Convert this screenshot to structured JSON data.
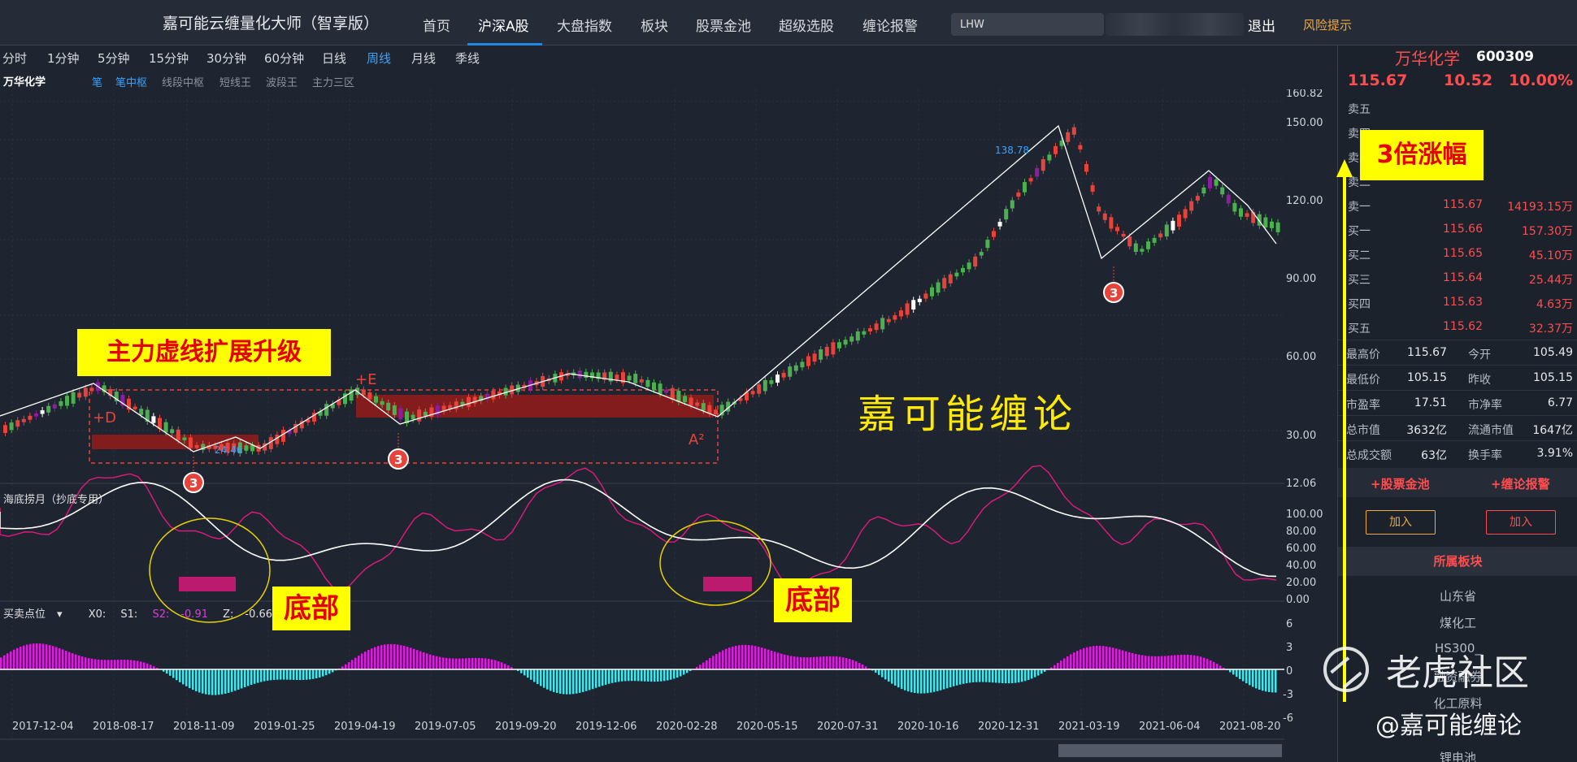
{
  "app": {
    "title": "嘉可能云缠量化大师（智享版）",
    "nav": [
      "首页",
      "沪深A股",
      "大盘指数",
      "板块",
      "股票金池",
      "超级选股",
      "缠论报警"
    ],
    "search_value": "LHW",
    "logout": "退出",
    "risk": "风险提示"
  },
  "periods": [
    "分时",
    "1分钟",
    "5分钟",
    "15分钟",
    "30分钟",
    "60分钟",
    "日线",
    "周线",
    "月线",
    "季线"
  ],
  "active_period": "周线",
  "indicator_bar": {
    "stock": "万华化学",
    "items": [
      "笔",
      "笔中枢",
      "线段中枢",
      "短线王",
      "波段王",
      "主力三区"
    ]
  },
  "main_chart": {
    "y_ticks": [
      "160.82",
      "150.00",
      "120.00",
      "90.00",
      "60.00",
      "30.00",
      "12.06"
    ],
    "price_marks": [
      "138.78",
      "24.46"
    ],
    "labels": [
      "+D",
      "+E",
      "A²"
    ],
    "badge": "3"
  },
  "oscillator": {
    "title": "海底捞月（抄底专用）",
    "y_ticks": [
      "100.00",
      "80.00",
      "60.00",
      "40.00",
      "20.00",
      "0.00"
    ]
  },
  "buy_sell": {
    "title": "买卖点位",
    "x0_label": "X0:",
    "s1_label": "S1:",
    "s2_label": "S2:",
    "s2_value": "-0.91",
    "z_label": "Z:",
    "z_value": "-0.66",
    "y_ticks": [
      "6",
      "3",
      "0",
      "-3",
      "-6"
    ]
  },
  "x_dates": [
    "2017-12-04",
    "2018-08-17",
    "2018-11-09",
    "2019-01-25",
    "2019-04-19",
    "2019-07-05",
    "2019-09-20",
    "2019-12-06",
    "2020-02-28",
    "2020-05-15",
    "2020-07-31",
    "2020-10-16",
    "2020-12-31",
    "2021-03-19",
    "2021-06-04",
    "2021-08-20"
  ],
  "quote": {
    "name": "万华化学",
    "code": "600309",
    "price": "115.67",
    "change": "10.52",
    "pct": "10.00%",
    "sells_empty": [
      "卖五",
      "卖四",
      "卖三",
      "卖二"
    ],
    "sell1": {
      "label": "卖一",
      "price": "115.67",
      "vol": "14193.15万"
    },
    "buy1": {
      "label": "买一",
      "price": "115.66",
      "vol": "157.30万"
    },
    "buy2": {
      "label": "买二",
      "price": "115.65",
      "vol": "45.10万"
    },
    "buy3": {
      "label": "买三",
      "price": "115.64",
      "vol": "25.44万"
    },
    "buy4": {
      "label": "买四",
      "price": "115.63",
      "vol": "4.63万"
    },
    "buy5": {
      "label": "买五",
      "price": "115.62",
      "vol": "32.37万"
    }
  },
  "stats": [
    [
      "最高价",
      "115.67",
      "今开",
      "105.49"
    ],
    [
      "最低价",
      "105.15",
      "昨收",
      "105.15"
    ],
    [
      "市盈率",
      "17.51",
      "市净率",
      "6.77"
    ],
    [
      "总市值",
      "3632亿",
      "流通市值",
      "1647亿"
    ],
    [
      "总成交额",
      "63亿",
      "换手率",
      "3.91%"
    ]
  ],
  "panel_tabs": [
    "+股票金池",
    "+缠论报警"
  ],
  "add_label": "加入",
  "sector_head": "所属板块",
  "sectors": [
    "山东省",
    "煤化工",
    "HS300_",
    "融资融券",
    "化工原料",
    "锂电池"
  ],
  "annotations": {
    "upgrade": "主力虚线扩展升级",
    "triple": "3倍涨幅",
    "bottom": "底部",
    "chan": "嘉可能缠论"
  },
  "watermark": {
    "brand": "老虎社区",
    "author": "@嘉可能缠论"
  },
  "colors": {
    "up": "#e8433a",
    "down": "#4caf50",
    "purple": "#8b1e9e",
    "zone": "#8e1c1c",
    "accent": "#1e88e5"
  }
}
